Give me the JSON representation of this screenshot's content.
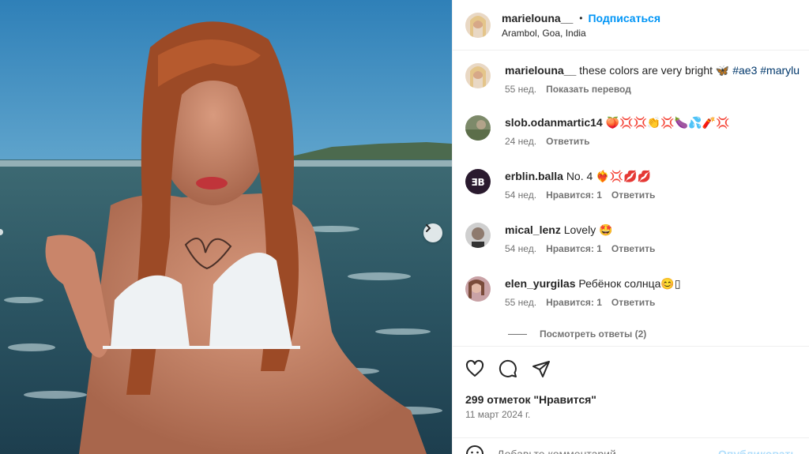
{
  "post": {
    "author": "marielouna__",
    "separator": "•",
    "follow_label": "Подписаться",
    "location": "Arambol, Goa, India"
  },
  "caption": {
    "username": "marielouna__",
    "text": "these colors are very bright 🦋",
    "hashtags": "#ae3 #marylu",
    "time": "55 нед.",
    "translate_label": "Показать перевод"
  },
  "comments": [
    {
      "username": "slob.odanmartic14",
      "text": "🍑💢💢👏💢🍆💦🧨💢",
      "time": "24 нед.",
      "likes": "",
      "reply": "Ответить"
    },
    {
      "username": "erblin.balla",
      "text": "No. 4 ❤️‍🔥💢💋💋",
      "time": "54 нед.",
      "likes": "Нравится: 1",
      "reply": "Ответить"
    },
    {
      "username": "mical_lenz",
      "text": "Lovely 🤩",
      "time": "54 нед.",
      "likes": "Нравится: 1",
      "reply": "Ответить"
    },
    {
      "username": "elen_yurgilas",
      "text": "Ребёнок солнца😊▯",
      "time": "55 нед.",
      "likes": "Нравится: 1",
      "reply": "Ответить"
    }
  ],
  "view_replies": "Посмотреть ответы (2)",
  "stats": {
    "likes": "299 отметок \"Нравится\"",
    "date": "11 март 2024 г."
  },
  "add_comment": {
    "placeholder": "Добавьте комментарий...",
    "post_label": "Опубликовать"
  },
  "icons": {
    "like": "heart-icon",
    "comment": "comment-icon",
    "share": "share-icon",
    "emoji": "smiley-icon",
    "next": "chevron-right-icon"
  },
  "colors": {
    "link": "#0095f6",
    "hashtag": "#00376b",
    "muted": "#737373"
  }
}
